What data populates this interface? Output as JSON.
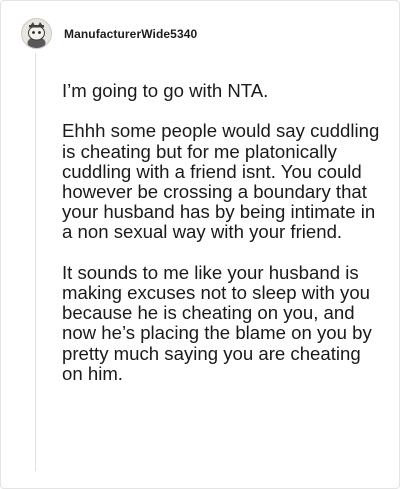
{
  "comment": {
    "author": "ManufacturerWide5340",
    "avatar_icon": "snoo-avatar-icon",
    "paragraphs": [
      "I’m going to go with NTA.",
      "Ehhh some people would say cuddling is cheating but for me platonically cuddling with a friend isnt. You could however be crossing a boundary that your husband has by being intimate in a non sexual way with your friend.",
      "It sounds to me like your husband is making excuses not to sleep with you because he is cheating on you, and now he’s placing the blame on you by pretty much saying you are cheating on him."
    ]
  }
}
